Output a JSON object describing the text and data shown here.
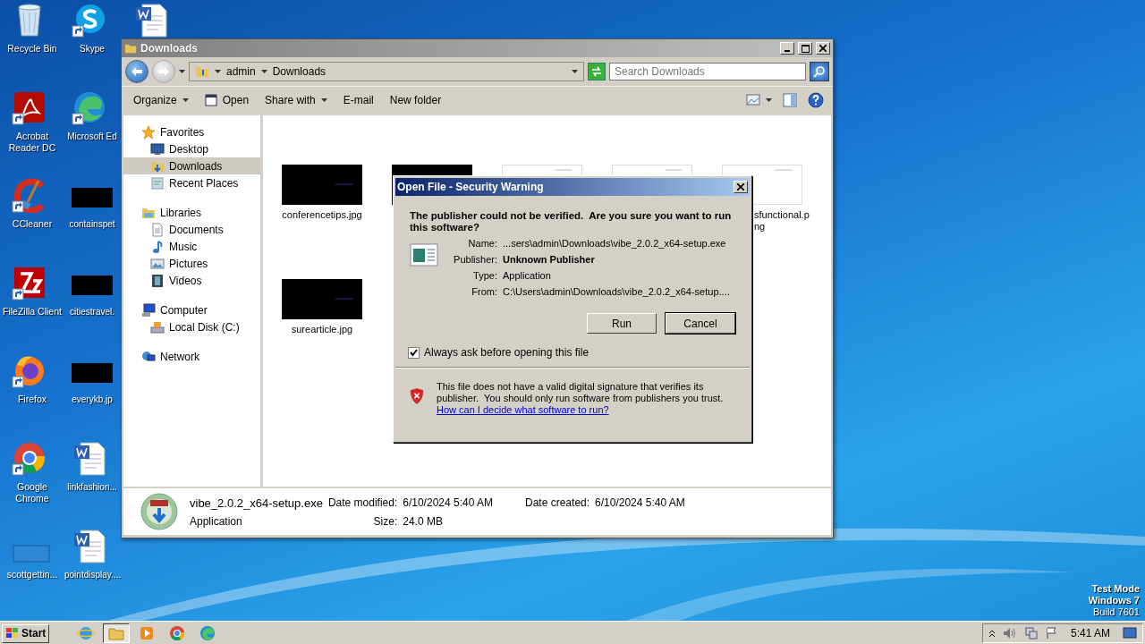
{
  "desktop": {
    "icons": [
      {
        "label": "Recycle Bin",
        "kind": "recycle",
        "shortcut": false
      },
      {
        "label": "Skype",
        "kind": "skype",
        "shortcut": true
      },
      {
        "kind": "word",
        "shortcut": false
      },
      {
        "label": "Acrobat Reader DC",
        "kind": "acrobat",
        "shortcut": true
      },
      {
        "label": "Microsoft Ed",
        "kind": "edge",
        "shortcut": true
      },
      {
        "kind": "none"
      },
      {
        "label": "CCleaner",
        "kind": "ccleaner",
        "shortcut": true
      },
      {
        "label": "containspet",
        "kind": "thumb",
        "shortcut": false
      },
      {
        "kind": "none"
      },
      {
        "label": "FileZilla Client",
        "kind": "filezilla",
        "shortcut": true
      },
      {
        "label": "citiestravel.",
        "kind": "thumb",
        "shortcut": false
      },
      {
        "kind": "none"
      },
      {
        "label": "Firefox",
        "kind": "firefox",
        "shortcut": true
      },
      {
        "label": "everykb.jp",
        "kind": "thumb",
        "shortcut": false
      },
      {
        "kind": "none"
      },
      {
        "label": "Google Chrome",
        "kind": "chrome",
        "shortcut": true
      },
      {
        "label": "linkfashion...",
        "kind": "word",
        "shortcut": false
      },
      {
        "kind": "none"
      },
      {
        "label": "scottgettin...",
        "kind": "blank",
        "shortcut": false
      },
      {
        "label": "pointdisplay....",
        "kind": "word",
        "shortcut": false
      }
    ],
    "test_mode_notice": [
      "Test Mode",
      "Windows 7",
      "Build 7601"
    ]
  },
  "explorer": {
    "title": "Downloads",
    "breadcrumb": [
      "admin",
      "Downloads"
    ],
    "search": {
      "placeholder": "Search Downloads"
    },
    "toolbar": [
      {
        "label": "Organize",
        "kind": "menu",
        "dropdown": true
      },
      {
        "label": "Open",
        "kind": "open",
        "dropdown": false
      },
      {
        "label": "Share with",
        "kind": "menu",
        "dropdown": true
      },
      {
        "label": "E-mail",
        "kind": "plain",
        "dropdown": false
      },
      {
        "label": "New folder",
        "kind": "plain",
        "dropdown": false
      }
    ],
    "nav": [
      {
        "label": "Favorites",
        "kind": "star",
        "selected": false,
        "children": [
          {
            "label": "Desktop",
            "kind": "desktop",
            "selected": false
          },
          {
            "label": "Downloads",
            "kind": "downloads",
            "selected": true
          },
          {
            "label": "Recent Places",
            "kind": "recent",
            "selected": false
          }
        ]
      },
      {
        "label": "Libraries",
        "kind": "library",
        "selected": false,
        "children": [
          {
            "label": "Documents",
            "kind": "documents",
            "selected": false
          },
          {
            "label": "Music",
            "kind": "music",
            "selected": false
          },
          {
            "label": "Pictures",
            "kind": "pictures",
            "selected": false
          },
          {
            "label": "Videos",
            "kind": "videos",
            "selected": false
          }
        ]
      },
      {
        "label": "Computer",
        "kind": "computer",
        "selected": false,
        "children": [
          {
            "label": "Local Disk (C:)",
            "kind": "disk",
            "selected": false
          }
        ]
      },
      {
        "label": "Network",
        "kind": "network",
        "selected": false
      }
    ],
    "files": [
      {
        "name": "conferencetips.jpg",
        "kind": "dark"
      },
      {
        "kind": "dark"
      },
      {
        "kind": "light"
      },
      {
        "kind": "light"
      },
      {
        "name": "sfunctional.png",
        "kind": "light"
      },
      {
        "name": "surearticle.jpg",
        "kind": "dark"
      }
    ],
    "details": {
      "name": "vibe_2.0.2_x64-setup.exe",
      "type": "Application",
      "fields": [
        {
          "label": "Date modified:",
          "value": "6/10/2024 5:40 AM"
        },
        {
          "label": "Date created:",
          "value": "6/10/2024 5:40 AM"
        },
        {
          "label": "Size:",
          "value": "24.0 MB"
        }
      ]
    }
  },
  "dialog": {
    "title": "Open File - Security Warning",
    "heading": "The publisher could not be verified.  Are you sure you want to run this software?",
    "fields": [
      {
        "label": "Name:",
        "value": "...sers\\admin\\Downloads\\vibe_2.0.2_x64-setup.exe",
        "emphasis": false
      },
      {
        "label": "Publisher:",
        "value": "Unknown Publisher",
        "emphasis": true
      },
      {
        "label": "Type:",
        "value": "Application",
        "emphasis": false
      },
      {
        "label": "From:",
        "value": "C:\\Users\\admin\\Downloads\\vibe_2.0.2_x64-setup....",
        "emphasis": false
      }
    ],
    "buttons": [
      {
        "label": "Run",
        "focused": false
      },
      {
        "label": "Cancel",
        "focused": true
      }
    ],
    "checkbox": {
      "label": "Always ask before opening this file",
      "checked": true
    },
    "warning": "This file does not have a valid digital signature that verifies its publisher.  You should only run software from publishers you trust.",
    "link": "How can I decide what software to run?"
  },
  "taskbar": {
    "start": "Start",
    "apps": [
      {
        "kind": "ie",
        "selected": false
      },
      {
        "kind": "explorer",
        "selected": true
      },
      {
        "kind": "media",
        "selected": false
      },
      {
        "kind": "chrome",
        "selected": false
      },
      {
        "kind": "edge",
        "selected": false
      }
    ],
    "clock": "5:41 AM"
  }
}
